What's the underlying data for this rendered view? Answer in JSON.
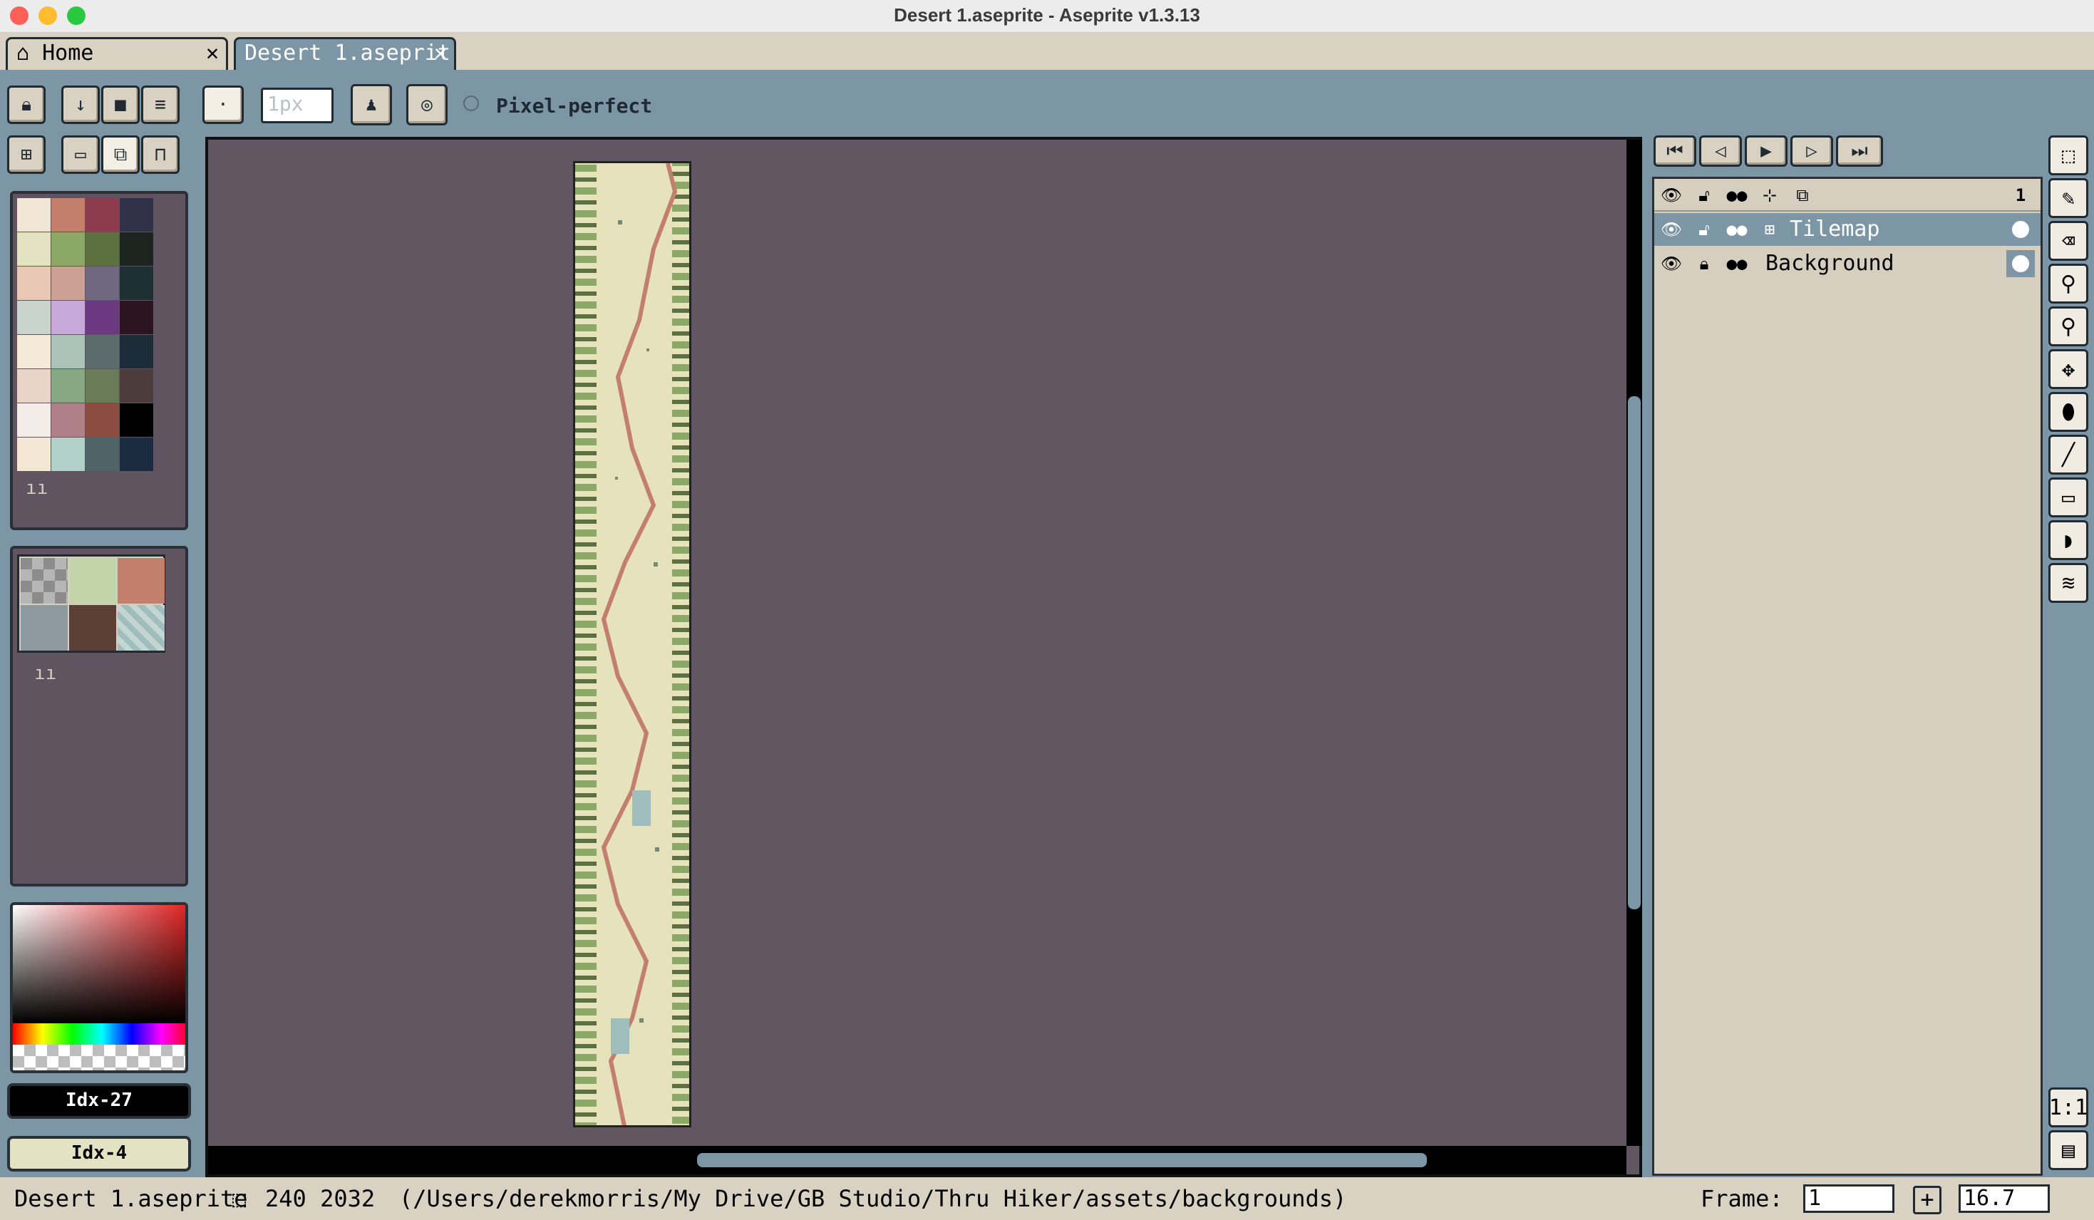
{
  "window": {
    "title": "Desert 1.aseprite - Aseprite v1.3.13"
  },
  "tabs": [
    {
      "label": "Home",
      "close": "✕"
    },
    {
      "label": "Desert 1.aseprit",
      "close": "✕"
    }
  ],
  "toolbar": {
    "brush_size": "1px",
    "pixel_perfect_label": "Pixel-perfect"
  },
  "palette": {
    "colors": [
      "#f0e6d6",
      "#c2806c",
      "#8c3c4c",
      "#303048",
      "#e3e2c2",
      "#8ca866",
      "#5c7040",
      "#1c2420",
      "#e8c8b4",
      "#cca094",
      "#706880",
      "#1c3034",
      "#c8d4cc",
      "#c8a8d8",
      "#6c3880",
      "#2c1420",
      "#f4ead8",
      "#acc4b8",
      "#5c6c6c",
      "#1c2c38",
      "#ead4c8",
      "#88a884",
      "#687c58",
      "#4c3c3c",
      "#f4ece6",
      "#b08088",
      "#8c4c40",
      "#000000",
      "#f4e8d4",
      "#b0d0c8",
      "#506468",
      "#1c2c40"
    ]
  },
  "color_bar": {
    "fg_label": "Idx-27",
    "bg_label": "Idx-4"
  },
  "timeline": {
    "frame_number": "1",
    "layers": [
      {
        "name": "Tilemap",
        "selected": true
      },
      {
        "name": "Background",
        "selected": false
      }
    ]
  },
  "status": {
    "filename": "Desert 1.aseprite",
    "dimensions": "240 2032",
    "path": "(/Users/derekmorris/My Drive/GB Studio/Thru Hiker/assets/backgrounds)",
    "frame_label": "Frame:",
    "frame_value": "1",
    "zoom": "16.7"
  },
  "side_tools": [
    "rect-select-icon",
    "pencil-icon",
    "eraser-icon",
    "eyedropper-icon",
    "zoom-icon",
    "move-icon",
    "fill-icon",
    "line-icon",
    "rectangle-icon",
    "contour-icon",
    "blur-icon"
  ]
}
